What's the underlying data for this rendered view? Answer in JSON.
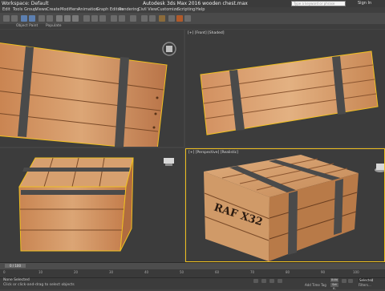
{
  "app": {
    "workspace_label": "Workspace: Default",
    "title": "Autodesk 3ds Max 2016    wooden chest.max",
    "search_placeholder": "Type a keyword or phrase",
    "sign_in": "Sign In"
  },
  "menu": [
    "Edit",
    "Tools",
    "Group",
    "Views",
    "Create",
    "Modifiers",
    "Animation",
    "Graph Editors",
    "Rendering",
    "Civil View",
    "Customize",
    "Scripting",
    "Help"
  ],
  "ribbon": [
    "Object Paint",
    "Populate"
  ],
  "viewports": {
    "top_left": {
      "label": ""
    },
    "top_right": {
      "label": "[+] [Front] [Shaded]"
    },
    "bottom_left": {
      "label": ""
    },
    "bottom_right": {
      "label": "[+] [Perspective] [Realistic]"
    }
  },
  "crate_text": "RAF X32",
  "timeline": {
    "frame_counter": "0 / 100",
    "ticks": [
      "0",
      "10",
      "20",
      "30",
      "40",
      "50",
      "60",
      "70",
      "80",
      "90",
      "100"
    ]
  },
  "status": {
    "line1": "None Selected",
    "line2": "Click or click-and-drag to select objects",
    "add_time_tag": "Add Time Tag",
    "key_filter": "Selected",
    "filters": "Filters...",
    "auto_key": "Auto",
    "set_key": "Set K."
  },
  "colors": {
    "wood_light": "#d9a06e",
    "wood_dark": "#b7744a",
    "strap": "#4a4a4a",
    "selection": "#f0c020",
    "viewport_bg": "#3c3c3c"
  }
}
